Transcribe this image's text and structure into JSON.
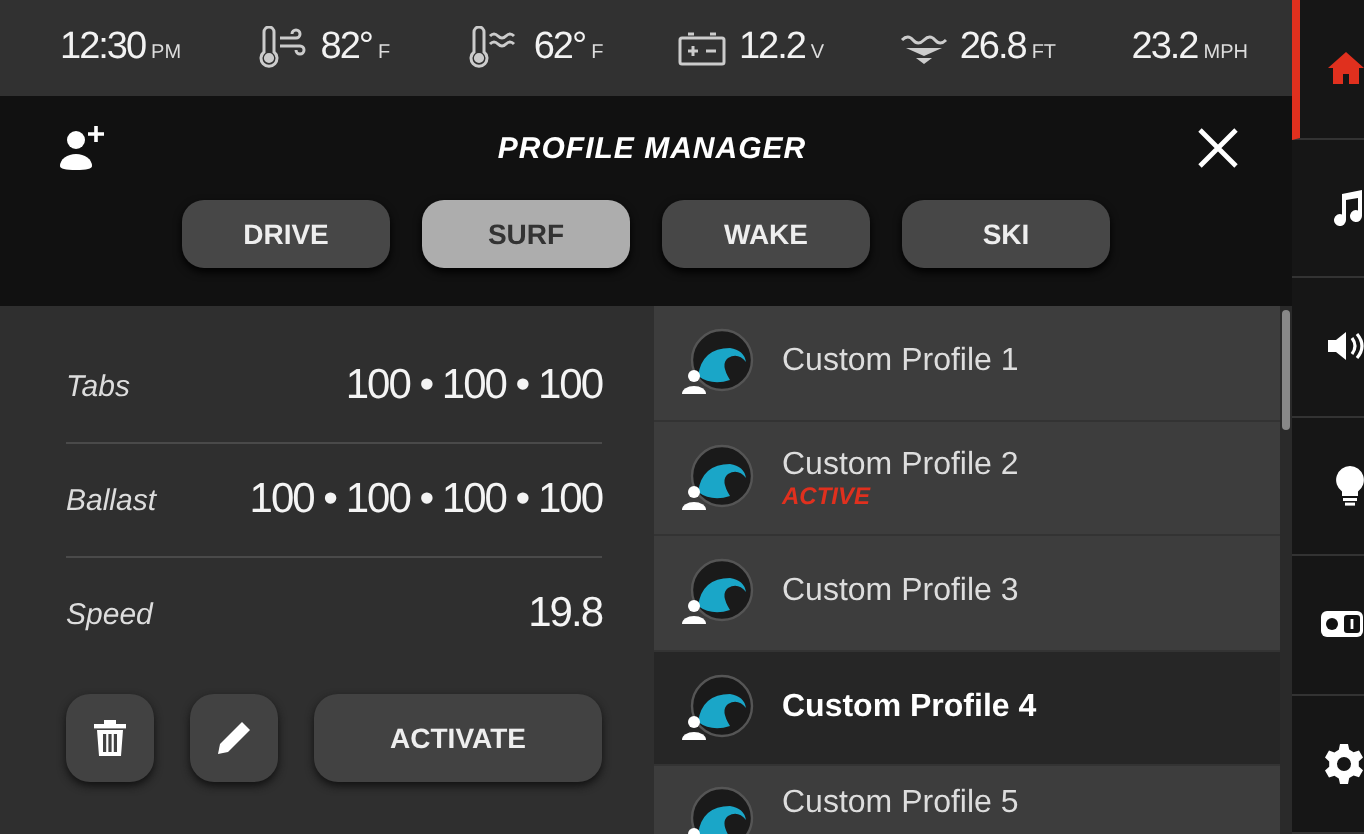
{
  "status_bar": {
    "time": {
      "value": "12:30",
      "unit": "PM"
    },
    "readings": [
      {
        "kind": "air_temp",
        "value": "82°",
        "unit": "F"
      },
      {
        "kind": "water_temp",
        "value": "62°",
        "unit": "F"
      },
      {
        "kind": "battery",
        "value": "12.2",
        "unit": "V"
      },
      {
        "kind": "depth",
        "value": "26.8",
        "unit": "FT"
      },
      {
        "kind": "speed",
        "value": "23.2",
        "unit": "MPH"
      }
    ]
  },
  "header": {
    "title": "PROFILE MANAGER",
    "tabs": [
      {
        "label": "DRIVE",
        "selected": false
      },
      {
        "label": "SURF",
        "selected": true
      },
      {
        "label": "WAKE",
        "selected": false
      },
      {
        "label": "SKI",
        "selected": false
      }
    ]
  },
  "details": {
    "rows": [
      {
        "label": "Tabs",
        "value": "100 • 100 • 100"
      },
      {
        "label": "Ballast",
        "value": "100 • 100 • 100 • 100"
      },
      {
        "label": "Speed",
        "value": "19.8"
      }
    ],
    "activate_button": "ACTIVATE"
  },
  "profiles": [
    {
      "name": "Custom Profile 1",
      "selected": false
    },
    {
      "name": "Custom Profile 2",
      "selected": false,
      "status": "ACTIVE"
    },
    {
      "name": "Custom Profile 3",
      "selected": false
    },
    {
      "name": "Custom Profile 4",
      "selected": true
    },
    {
      "name": "Custom Profile 5",
      "selected": false
    }
  ],
  "side_nav": [
    {
      "kind": "home",
      "selected": true
    },
    {
      "kind": "music",
      "selected": false
    },
    {
      "kind": "volume",
      "selected": false
    },
    {
      "kind": "light",
      "selected": false
    },
    {
      "kind": "switch",
      "selected": false
    },
    {
      "kind": "settings",
      "selected": false
    }
  ]
}
